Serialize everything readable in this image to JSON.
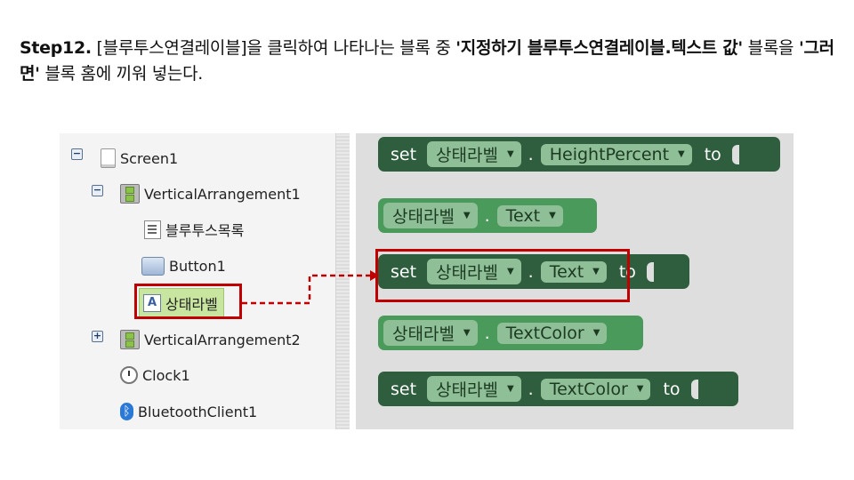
{
  "heading": {
    "step": "Step12.",
    "part1": " [블루투스연결레이블]을 클릭하여 나타나는 블록 중 ",
    "part2": "'지정하기 블루투스연결레이블.텍스트 값'",
    "part3": " 블록을 ",
    "part4": "'그러면'",
    "part5": " 블록 홈에 끼워 넣는다."
  },
  "tree": {
    "screen1": {
      "label": "Screen1",
      "toggle": "⊟"
    },
    "va1": {
      "label": "VerticalArrangement1",
      "toggle": "⊟"
    },
    "list": {
      "label": "블루투스목록"
    },
    "button1": {
      "label": "Button1"
    },
    "statusLabel": {
      "label": "상태라벨",
      "icon_text": "A"
    },
    "va2": {
      "label": "VerticalArrangement2",
      "toggle": "⊞"
    },
    "clock1": {
      "label": "Clock1"
    },
    "bt": {
      "label": "BluetoothClient1",
      "icon_text": "ᛒ"
    }
  },
  "blocks": {
    "b1": {
      "kw": "set",
      "component": "상태라벨",
      "dot": ".",
      "property": "HeightPercent",
      "to": "to"
    },
    "b2": {
      "component": "상태라벨",
      "dot": ".",
      "property": "Text"
    },
    "b3": {
      "kw": "set",
      "component": "상태라벨",
      "dot": ".",
      "property": "Text",
      "to": "to"
    },
    "b4": {
      "component": "상태라벨",
      "dot": ".",
      "property": "TextColor"
    },
    "b5": {
      "kw": "set",
      "component": "상태라벨",
      "dot": ".",
      "property": "TextColor",
      "to": "to"
    }
  },
  "dropdown_arrow": "▼",
  "colors": {
    "set_block": "#2e5e3e",
    "get_block": "#4a9a5c",
    "highlight": "#c00000",
    "selected_node": "#c8e6a0"
  }
}
